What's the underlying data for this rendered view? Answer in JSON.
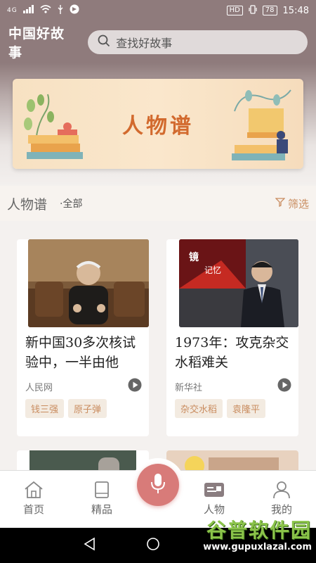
{
  "status": {
    "network": "4G",
    "battery": "78",
    "time": "15:48",
    "hd": "HD"
  },
  "header": {
    "app_title": "中国好故事",
    "search_placeholder": "查找好故事"
  },
  "banner": {
    "title": "人物谱"
  },
  "section": {
    "title": "人物谱",
    "subtitle": "·全部",
    "filter_label": "筛选"
  },
  "cards": [
    {
      "title": "新中国30多次核试验中，一半由他",
      "source": "人民网",
      "tags": [
        "钱三强",
        "原子弹"
      ]
    },
    {
      "title": "1973年：攻克杂交水稻难关",
      "source": "新华社",
      "tags": [
        "杂交水稻",
        "袁隆平"
      ],
      "photo_caption_a": "镜",
      "photo_caption_b": "记忆"
    }
  ],
  "tabbar": {
    "home": "首页",
    "featured": "精品",
    "people": "人物",
    "mine": "我的"
  },
  "watermark": {
    "cn": "谷普软件园",
    "url": "www.gupuxlazal.com"
  },
  "colors": {
    "header": "#8f7b7c",
    "accent": "#c98c5f",
    "mic": "#d87b79",
    "banner_title": "#d26a2e"
  }
}
